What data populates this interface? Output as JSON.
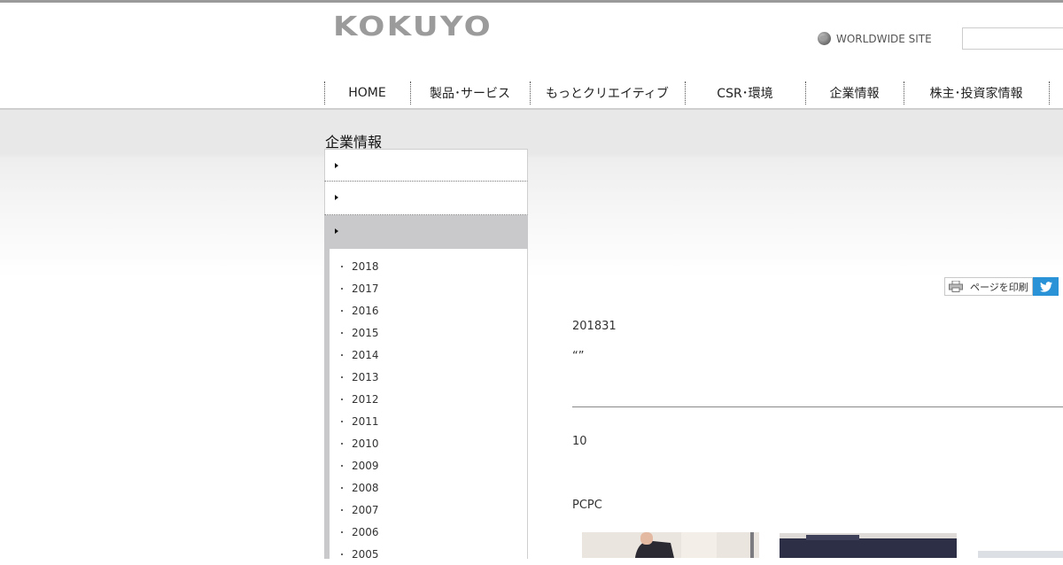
{
  "header": {
    "logo_text": "KOKUYO",
    "worldwide_label": "WORLDWIDE SITE",
    "search_placeholder": ""
  },
  "gnav": [
    {
      "label": "HOME",
      "active": false
    },
    {
      "label": "製品･サービス",
      "active": false
    },
    {
      "label": "もっとクリエイティブ",
      "active": false
    },
    {
      "label": "CSR･環境",
      "active": false
    },
    {
      "label": "企業情報",
      "active": true
    },
    {
      "label": "株主･投資家情報",
      "active": false
    }
  ],
  "page_title": "企業情報",
  "sidemenu": {
    "items": [
      {
        "label": ""
      },
      {
        "label": ""
      },
      {
        "label": ""
      }
    ],
    "years": [
      "2018",
      "2017",
      "2016",
      "2015",
      "2014",
      "2013",
      "2012",
      "2011",
      "2010",
      "2009",
      "2008",
      "2007",
      "2006",
      "2005"
    ]
  },
  "tools": {
    "print_label": "ページを印刷"
  },
  "content": {
    "date": "201831",
    "quote": "“”",
    "para1": "10",
    "para2": "PCPC"
  },
  "colors": {
    "accent": "#d0021b",
    "twitter": "#2a93d8",
    "menu_active": "#c9c9cb"
  }
}
